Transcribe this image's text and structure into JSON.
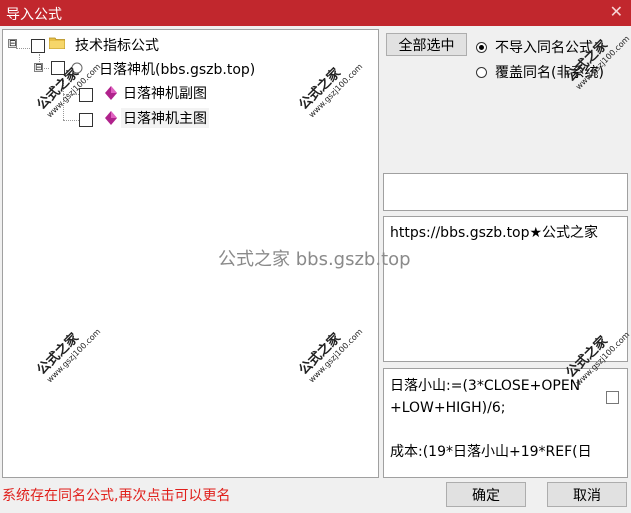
{
  "window": {
    "title": "导入公式",
    "close_glyph": "✕"
  },
  "tree": {
    "root": {
      "label": "技术指标公式",
      "expander": "⊟"
    },
    "group": {
      "label": "日落神机(bbs.gszb.top)",
      "expander": "⊟"
    },
    "items": [
      {
        "label": "日落神机副图"
      },
      {
        "label": "日落神机主图"
      }
    ]
  },
  "controls": {
    "select_all_label": "全部选中",
    "radio_options": [
      {
        "label": "不导入同名公式",
        "selected": true
      },
      {
        "label": "覆盖同名(非系统)",
        "selected": false
      }
    ]
  },
  "description_text": "https://bbs.gszb.top★公式之家",
  "formula_text_line1": "日落小山:=(3*CLOSE+OPEN",
  "formula_text_line2": "+LOW+HIGH)/6;",
  "formula_text_line3": "成本:(19*日落小山+19*REF(日",
  "status_message": "系统存在同名公式,再次点击可以更名",
  "buttons": {
    "ok_label": "确定",
    "cancel_label": "取消"
  },
  "watermark": {
    "cn": "公式之家",
    "url": "www.gszj100.com"
  },
  "center_watermark": "公式之家 bbs.gszb.top",
  "colors": {
    "titlebar": "#c1272d",
    "status": "#e0201c"
  }
}
